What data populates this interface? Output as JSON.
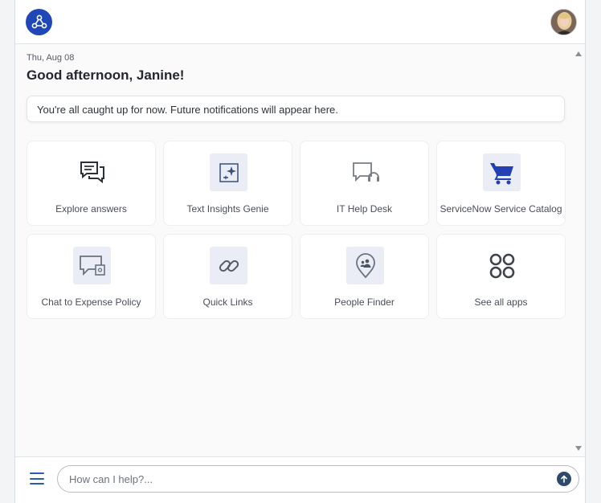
{
  "header": {
    "logo_icon": "network-hub-icon",
    "avatar_icon": "user-avatar"
  },
  "home": {
    "date": "Thu, Aug 08",
    "greeting": "Good afternoon, Janine!",
    "notification": "You're all caught up for now. Future notifications will appear here."
  },
  "tiles": [
    {
      "label": "Explore answers",
      "icon": "chat-bubbles-icon"
    },
    {
      "label": "Text Insights Genie",
      "icon": "sparkle-document-icon"
    },
    {
      "label": "IT Help Desk",
      "icon": "headset-chat-icon"
    },
    {
      "label": "ServiceNow Service Catalog",
      "icon": "shopping-cart-icon"
    },
    {
      "label": "Chat to Expense Policy",
      "icon": "chat-document-icon"
    },
    {
      "label": "Quick Links",
      "icon": "link-icon"
    },
    {
      "label": "People Finder",
      "icon": "people-pin-icon"
    },
    {
      "label": "See all apps",
      "icon": "apps-grid-icon"
    }
  ],
  "composer": {
    "placeholder": "How can I help?...",
    "menu_icon": "hamburger-menu-icon",
    "send_icon": "send-arrow-icon"
  },
  "colors": {
    "brand": "#1f47b8",
    "accent": "#2c5cad",
    "send": "#2d4a6b",
    "cart": "#2340b5"
  }
}
